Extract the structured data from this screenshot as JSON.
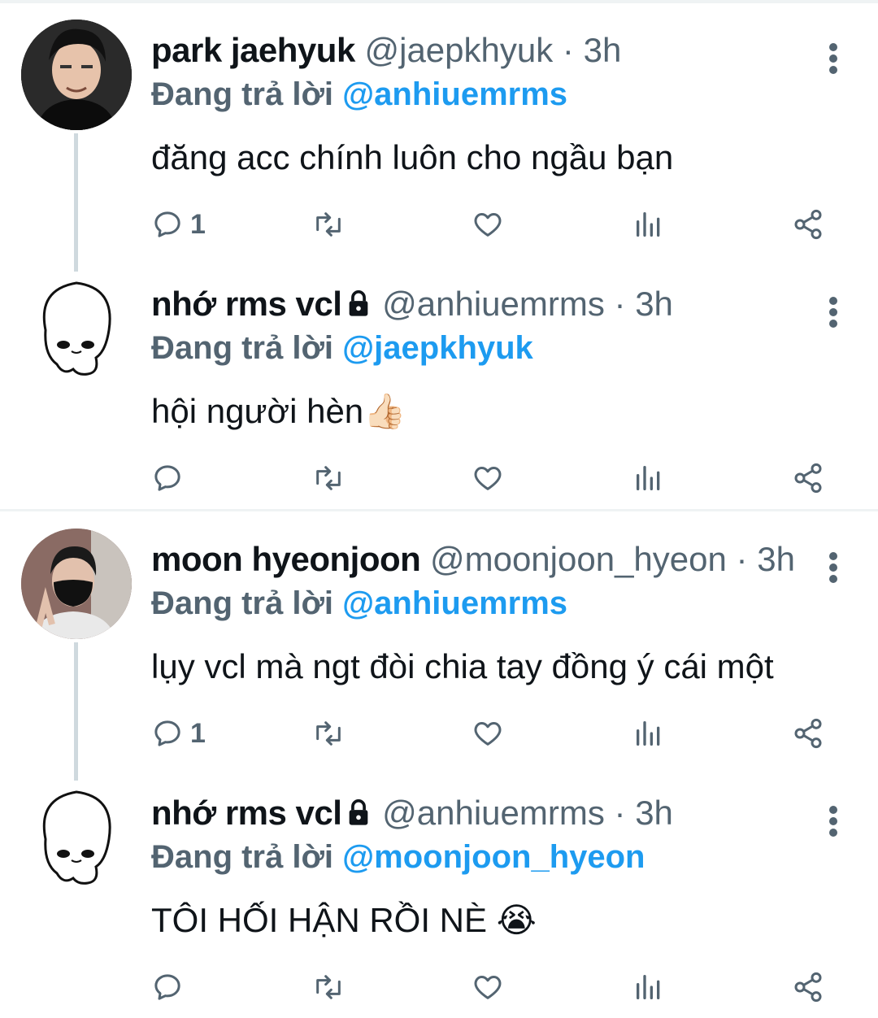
{
  "tweets": [
    {
      "name": "park jaehyuk",
      "handle": "@jaepkhyuk",
      "separator": "·",
      "time": "3h",
      "locked": false,
      "reply_prefix": "Đang trả lời",
      "reply_to": "@anhiuemrms",
      "text": "đăng acc chính luôn cho ngầu bạn",
      "reply_count": "1",
      "avatar": "photo-avatar"
    },
    {
      "name": "nhớ rms vcl",
      "handle": "@anhiuemrms",
      "separator": "·",
      "time": "3h",
      "locked": true,
      "reply_prefix": "Đang trả lời",
      "reply_to": "@jaepkhyuk",
      "text": "hội người hèn👍🏻",
      "reply_count": "",
      "avatar": "sketch-avatar"
    },
    {
      "name": "moon hyeonjoon",
      "handle": "@moonjoon_hyeon",
      "separator": "·",
      "time": "3h",
      "locked": false,
      "reply_prefix": "Đang trả lời",
      "reply_to": "@anhiuemrms",
      "text": "lụy vcl mà ngt đòi chia tay đồng ý cái một",
      "reply_count": "1",
      "avatar": "photo-avatar"
    },
    {
      "name": "nhớ rms vcl",
      "handle": "@anhiuemrms",
      "separator": "·",
      "time": "3h",
      "locked": true,
      "reply_prefix": "Đang trả lời",
      "reply_to": "@moonjoon_hyeon",
      "text": "TÔI HỐI HẬN RỒI NÈ 😭",
      "reply_count": "",
      "avatar": "sketch-avatar"
    }
  ],
  "icons": {
    "reply": "reply-icon",
    "retweet": "retweet-icon",
    "like": "heart-icon",
    "analytics": "analytics-icon",
    "share": "share-icon",
    "more": "more-vertical-icon",
    "lock": "lock-icon"
  },
  "colors": {
    "mention": "#1d9bf0",
    "secondary_text": "#536471",
    "thread_line": "#cfd9de",
    "divider": "#eff3f4"
  }
}
